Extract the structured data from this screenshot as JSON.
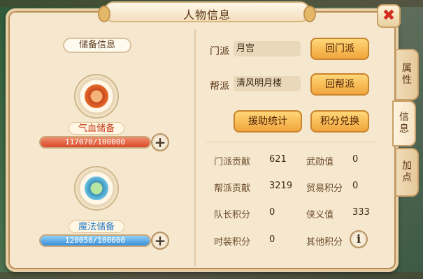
{
  "window": {
    "title": "人物信息"
  },
  "reserve": {
    "section_title": "储备信息",
    "hp": {
      "label": "气血储备",
      "bar_text": "117070/100000",
      "current": 117070,
      "max": 100000,
      "color": "#e05a3a"
    },
    "mp": {
      "label": "魔法储备",
      "bar_text": "120050/100000",
      "current": 120050,
      "max": 100000,
      "color": "#4a9ee6"
    }
  },
  "sect": {
    "label": "门派",
    "value": "月宫",
    "button": "回门派"
  },
  "gang": {
    "label": "帮派",
    "value": "清风明月楼",
    "button": "回帮派"
  },
  "actions": {
    "aid_stats": "援助统计",
    "points_exchange": "积分兑换"
  },
  "stats": [
    {
      "label": "门派贡献",
      "value": "621"
    },
    {
      "label": "武勋值",
      "value": "0"
    },
    {
      "label": "帮派贡献",
      "value": "3219"
    },
    {
      "label": "贸易积分",
      "value": "0"
    },
    {
      "label": "队长积分",
      "value": "0"
    },
    {
      "label": "侠义值",
      "value": "333"
    },
    {
      "label": "时装积分",
      "value": "0"
    },
    {
      "label": "其他积分",
      "value": ""
    }
  ],
  "tabs": {
    "attributes": "属性",
    "info": "信息",
    "add_points": "加点"
  },
  "icons": {
    "close": "close-icon",
    "plus": "plus-icon",
    "info": "info-icon",
    "hp_bowl": "red-soup-bowl-icon",
    "mp_bowl": "blue-soup-bowl-icon"
  },
  "colors": {
    "accent_button": "#f1a53c",
    "panel": "#f6e8cf",
    "close": "#d22b1f"
  }
}
